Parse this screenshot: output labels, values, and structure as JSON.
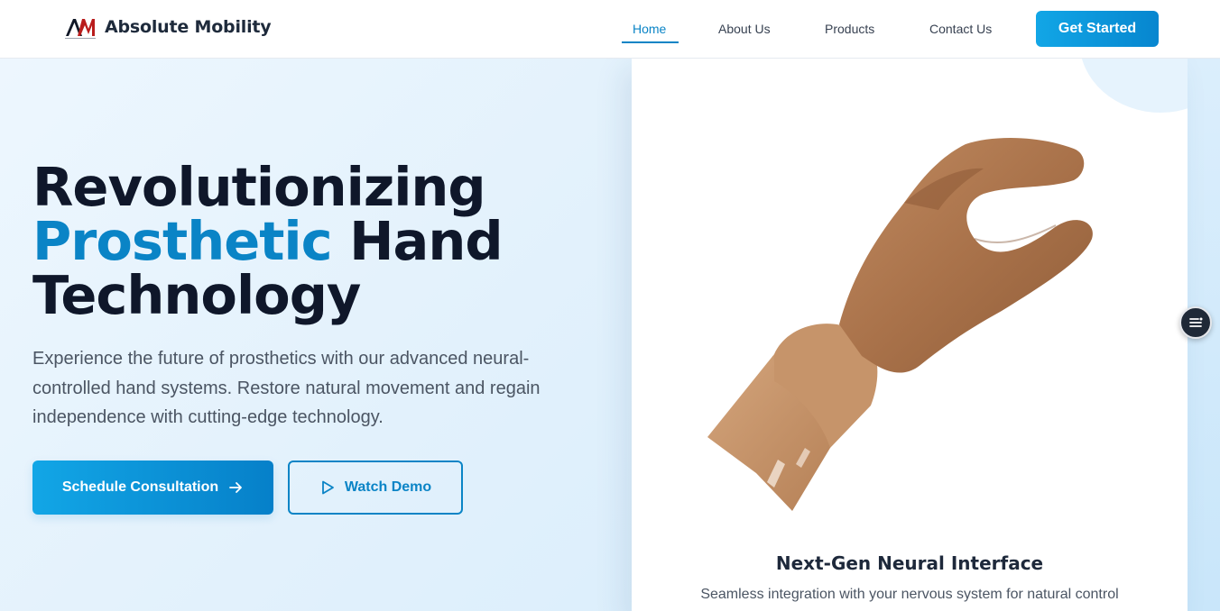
{
  "header": {
    "brand": "Absolute Mobility",
    "logo_text": "AM",
    "nav": [
      {
        "label": "Home",
        "active": true
      },
      {
        "label": "About Us",
        "active": false
      },
      {
        "label": "Products",
        "active": false
      },
      {
        "label": "Contact Us",
        "active": false
      }
    ],
    "cta_label": "Get Started"
  },
  "hero": {
    "title_line1": "Revolutionizing",
    "title_accent": "Prosthetic",
    "title_line2_rest": " Hand",
    "title_line3": "Technology",
    "description": "Experience the future of prosthetics with our advanced neural-controlled hand systems. Restore natural movement and regain independence with cutting-edge technology.",
    "primary_button": "Schedule Consultation",
    "secondary_button": "Watch Demo"
  },
  "card": {
    "title": "Next-Gen Neural Interface",
    "subtitle": "Seamless integration with your nervous system for natural control"
  },
  "icons": {
    "primary_button_icon": "arrow-right-icon",
    "secondary_button_icon": "play-icon",
    "floating_button_icon": "menu-icon"
  },
  "colors": {
    "accent": "#0a84c6",
    "cta_gradient_start": "#12a6e6",
    "heading": "#0f172a",
    "body_text": "#4b5563"
  }
}
